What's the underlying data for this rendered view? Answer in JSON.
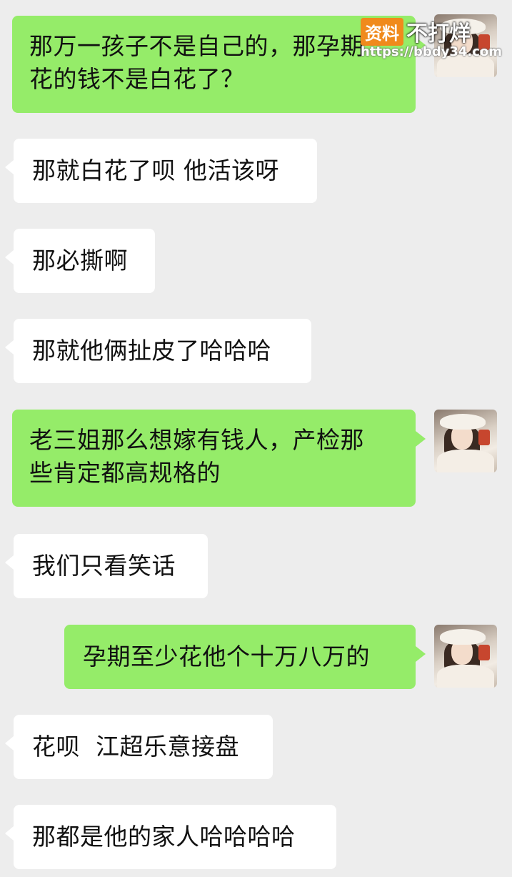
{
  "messages": [
    {
      "side": "out",
      "text": "那万一孩子不是自己的，那孕期\n花的钱不是白花了？"
    },
    {
      "side": "in",
      "text": "那就白花了呗 他活该呀"
    },
    {
      "side": "in",
      "text": "那必撕啊"
    },
    {
      "side": "in",
      "text": "那就他俩扯皮了哈哈哈"
    },
    {
      "side": "out",
      "text": "老三姐那么想嫁有钱人，产检那\n些肯定都高规格的"
    },
    {
      "side": "in",
      "text": "我们只看笑话"
    },
    {
      "side": "out",
      "text": "孕期至少花他个十万八万的"
    },
    {
      "side": "in",
      "text": "花呗  江超乐意接盘"
    },
    {
      "side": "in",
      "text": "那都是他的家人哈哈哈哈"
    }
  ],
  "watermark": {
    "badge": "资料",
    "text": "不打烊",
    "url": "https://bbdy34.com"
  },
  "colors": {
    "background": "#ededed",
    "outgoing_bubble": "#95ec69",
    "incoming_bubble": "#ffffff",
    "watermark_badge": "#f08a1c"
  }
}
